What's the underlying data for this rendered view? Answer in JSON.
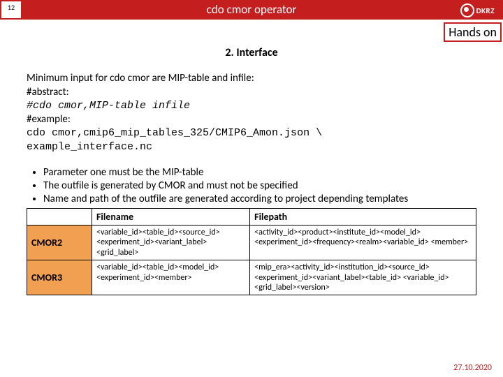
{
  "header": {
    "page_number": "12",
    "title": "cdo cmor operator",
    "logo_text": "DKRZ"
  },
  "hands_on": "Hands on",
  "section_title": "2. Interface",
  "intro": {
    "line1": "Minimum input for cdo cmor are MIP-table and infile:",
    "abstract_label": "#abstract:",
    "abstract_cmd": "#cdo cmor,MIP-table infile",
    "example_label": "#example:",
    "example_cmd1": "cdo cmor,cmip6_mip_tables_325/CMIP6_Amon.json \\",
    "example_cmd2": "example_interface.nc"
  },
  "bullets": [
    "Parameter one must be the MIP-table",
    "The outfile is generated by CMOR and must not be specified",
    "Name and path of the outfile are generated according to project depending templates"
  ],
  "table": {
    "headers": {
      "h1": "Filename",
      "h2": "Filepath"
    },
    "rows": [
      {
        "label": "CMOR2",
        "filename": "<variable_id><table_id><source_id> <experiment_id><variant_label> <grid_label>",
        "filepath": "<activity_id><product><institute_id><model_id> <experiment_id><frequency><realm><variable_id> <member>"
      },
      {
        "label": "CMOR3",
        "filename": "<variable_id><table_id><model_id> <experiment_id><member>",
        "filepath": "<mip_era><activity_id><institution_id><source_id> <experiment_id><variant_label><table_id> <variable_id><grid_label><version>"
      }
    ]
  },
  "footer_date": "27.10.2020"
}
